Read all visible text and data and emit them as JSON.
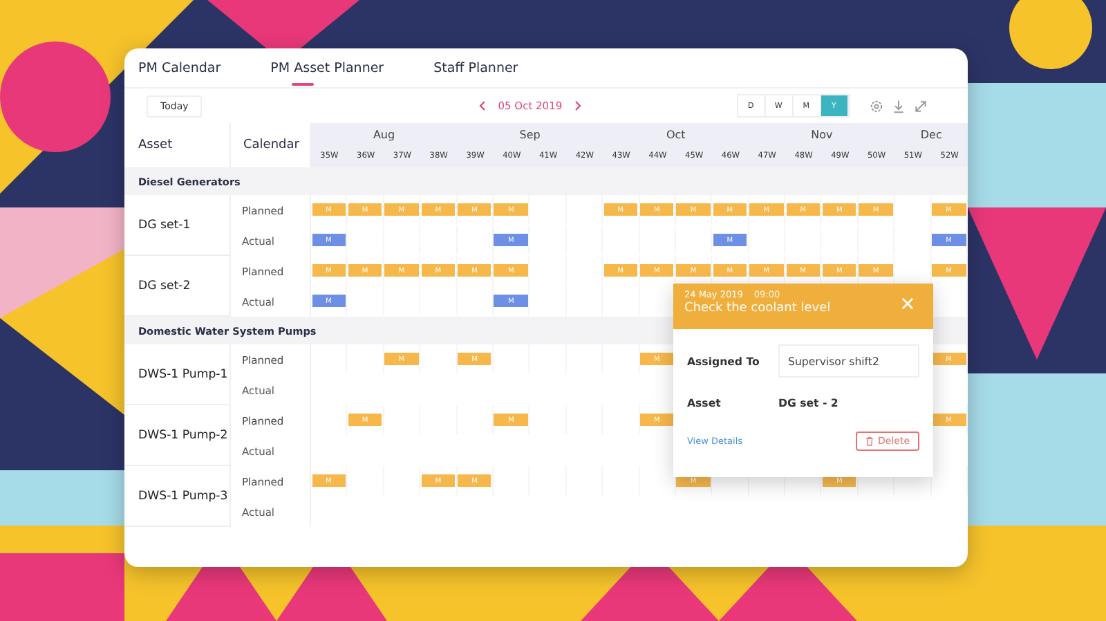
{
  "tabs": [
    {
      "label": "PM Calendar",
      "selected": false
    },
    {
      "label": "PM Asset Planner",
      "selected": true
    },
    {
      "label": "Staff Planner",
      "selected": false
    }
  ],
  "toolbar": {
    "today": "Today",
    "date": "05 Oct 2019",
    "views": [
      {
        "label": "D",
        "selected": false
      },
      {
        "label": "W",
        "selected": false
      },
      {
        "label": "M",
        "selected": false
      },
      {
        "label": "Y",
        "selected": true
      }
    ]
  },
  "grid": {
    "asset_heading": "Asset",
    "calendar_heading": "Calendar",
    "months": [
      {
        "label": "Aug",
        "weeks": [
          "35W",
          "36W",
          "37W",
          "38W"
        ]
      },
      {
        "label": "Sep",
        "weeks": [
          "39W",
          "40W",
          "41W",
          "42W"
        ]
      },
      {
        "label": "Oct",
        "weeks": [
          "43W",
          "44W",
          "45W",
          "46W"
        ]
      },
      {
        "label": "Nov",
        "weeks": [
          "47W",
          "48W",
          "49W",
          "50W"
        ]
      },
      {
        "label": "Dec",
        "weeks": [
          "51W",
          "52W"
        ]
      }
    ],
    "groups": [
      {
        "title": "Diesel Generators",
        "assets": [
          {
            "name": "DG set-1",
            "rows": [
              {
                "label": "Planned",
                "kind": "planned",
                "cells": [
                  {
                    "booked": true,
                    "label": "M"
                  },
                  {
                    "booked": true,
                    "label": "M"
                  },
                  {
                    "booked": true,
                    "label": "M"
                  },
                  {
                    "booked": true,
                    "label": "M"
                  },
                  {
                    "booked": true,
                    "label": "M"
                  },
                  {
                    "booked": true,
                    "label": "M"
                  },
                  {
                    "booked": false
                  },
                  {
                    "booked": false
                  },
                  {
                    "booked": true,
                    "label": "M"
                  },
                  {
                    "booked": true,
                    "label": "M"
                  },
                  {
                    "booked": true,
                    "label": "M"
                  },
                  {
                    "booked": true,
                    "label": "M"
                  },
                  {
                    "booked": true,
                    "label": "M"
                  },
                  {
                    "booked": true,
                    "label": "M"
                  },
                  {
                    "booked": true,
                    "label": "M"
                  },
                  {
                    "booked": true,
                    "label": "M"
                  },
                  {
                    "booked": false
                  },
                  {
                    "booked": true,
                    "label": "M"
                  }
                ]
              },
              {
                "label": "Actual",
                "kind": "actual",
                "cells": [
                  {
                    "booked": true,
                    "label": "M"
                  },
                  {
                    "booked": false
                  },
                  {
                    "booked": false
                  },
                  {
                    "booked": false
                  },
                  {
                    "booked": false
                  },
                  {
                    "booked": true,
                    "label": "M"
                  },
                  {
                    "booked": false
                  },
                  {
                    "booked": false
                  },
                  {
                    "booked": false
                  },
                  {
                    "booked": false
                  },
                  {
                    "booked": false
                  },
                  {
                    "booked": true,
                    "label": "M"
                  },
                  {
                    "booked": false
                  },
                  {
                    "booked": false
                  },
                  {
                    "booked": false
                  },
                  {
                    "booked": false
                  },
                  {
                    "booked": false
                  },
                  {
                    "booked": true,
                    "label": "M"
                  }
                ]
              }
            ]
          },
          {
            "name": "DG set-2",
            "rows": [
              {
                "label": "Planned",
                "kind": "planned",
                "cells": [
                  {
                    "booked": true,
                    "label": "M"
                  },
                  {
                    "booked": true,
                    "label": "M"
                  },
                  {
                    "booked": true,
                    "label": "M"
                  },
                  {
                    "booked": true,
                    "label": "M"
                  },
                  {
                    "booked": true,
                    "label": "M"
                  },
                  {
                    "booked": true,
                    "label": "M"
                  },
                  {
                    "booked": false
                  },
                  {
                    "booked": false
                  },
                  {
                    "booked": true,
                    "label": "M"
                  },
                  {
                    "booked": true,
                    "label": "M"
                  },
                  {
                    "booked": true,
                    "label": "M"
                  },
                  {
                    "booked": true,
                    "label": "M"
                  },
                  {
                    "booked": true,
                    "label": "M"
                  },
                  {
                    "booked": true,
                    "label": "M"
                  },
                  {
                    "booked": true,
                    "label": "M"
                  },
                  {
                    "booked": true,
                    "label": "M"
                  },
                  {
                    "booked": false
                  },
                  {
                    "booked": true,
                    "label": "M"
                  }
                ]
              },
              {
                "label": "Actual",
                "kind": "actual",
                "cells": [
                  {
                    "booked": true,
                    "label": "M"
                  },
                  {
                    "booked": false
                  },
                  {
                    "booked": false
                  },
                  {
                    "booked": false
                  },
                  {
                    "booked": false
                  },
                  {
                    "booked": true,
                    "label": "M"
                  },
                  {
                    "booked": false
                  },
                  {
                    "booked": false
                  },
                  {
                    "booked": false
                  },
                  {
                    "booked": false
                  }
                ],
                "cells_end": [
                  {
                    "booked": false
                  }
                ]
              }
            ]
          }
        ]
      },
      {
        "title": "Domestic Water System Pumps",
        "assets": [
          {
            "name": "DWS-1 Pump-1",
            "rows": [
              {
                "label": "Planned",
                "kind": "planned",
                "cells": [
                  {
                    "booked": false
                  },
                  {
                    "booked": false
                  },
                  {
                    "booked": true,
                    "label": "M"
                  },
                  {
                    "booked": false
                  },
                  {
                    "booked": true,
                    "label": "M"
                  },
                  {
                    "booked": false
                  },
                  {
                    "booked": false
                  },
                  {
                    "booked": false
                  },
                  {
                    "booked": false
                  },
                  {
                    "booked": true,
                    "label": "M"
                  }
                ],
                "cells_end": [
                  {
                    "booked": true,
                    "label": "M"
                  }
                ]
              },
              {
                "label": "Actual",
                "kind": "actual",
                "cells": []
              }
            ]
          },
          {
            "name": "DWS-1 Pump-2",
            "rows": [
              {
                "label": "Planned",
                "kind": "planned",
                "cells": [
                  {
                    "booked": false
                  },
                  {
                    "booked": true,
                    "label": "M"
                  },
                  {
                    "booked": false
                  },
                  {
                    "booked": false
                  },
                  {
                    "booked": false
                  },
                  {
                    "booked": true,
                    "label": "M"
                  },
                  {
                    "booked": false
                  },
                  {
                    "booked": false
                  },
                  {
                    "booked": false
                  },
                  {
                    "booked": true,
                    "label": "M"
                  }
                ],
                "cells_end": [
                  {
                    "booked": true,
                    "label": "M"
                  }
                ]
              },
              {
                "label": "Actual",
                "kind": "actual",
                "cells": []
              }
            ]
          },
          {
            "name": "DWS-1 Pump-3",
            "rows": [
              {
                "label": "Planned",
                "kind": "planned",
                "cells": [
                  {
                    "booked": true,
                    "label": "M"
                  },
                  {
                    "booked": false
                  },
                  {
                    "booked": false
                  },
                  {
                    "booked": true,
                    "label": "M"
                  },
                  {
                    "booked": true,
                    "label": "M"
                  },
                  {
                    "booked": false
                  },
                  {
                    "booked": false
                  },
                  {
                    "booked": false
                  },
                  {
                    "booked": false
                  },
                  {
                    "booked": false
                  },
                  {
                    "booked": true,
                    "label": "M"
                  },
                  {
                    "booked": false
                  },
                  {
                    "booked": false
                  },
                  {
                    "booked": false
                  },
                  {
                    "booked": true,
                    "label": "M"
                  },
                  {
                    "booked": false
                  },
                  {
                    "booked": false
                  },
                  {
                    "booked": false
                  }
                ]
              },
              {
                "label": "Actual",
                "kind": "actual",
                "cells": []
              }
            ]
          }
        ]
      }
    ]
  },
  "popup": {
    "date": "24 May 2019",
    "time": "09:00",
    "title": "Check the coolant level",
    "fields": [
      {
        "label": "Assigned To",
        "value": "Supervisor shift2",
        "kind": "input"
      },
      {
        "label": "Asset",
        "value": "DG set - 2",
        "kind": "text"
      }
    ],
    "link": "View Details",
    "delete": "Delete"
  }
}
